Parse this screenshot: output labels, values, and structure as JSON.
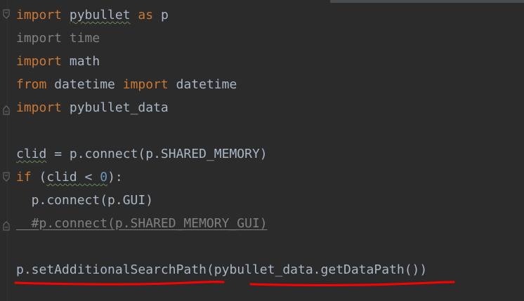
{
  "code": {
    "line1": {
      "kw1": "import",
      "mod": "pybullet",
      "kw2": "as",
      "alias": "p"
    },
    "line2": {
      "kw": "import",
      "mod": "time"
    },
    "line3": {
      "kw": "import",
      "mod": "math"
    },
    "line4": {
      "kw1": "from",
      "mod": "datetime",
      "kw2": "import",
      "name": "datetime"
    },
    "line5": {
      "kw": "import",
      "mod": "pybullet_data"
    },
    "line7": {
      "var": "clid",
      "rest": " = p.connect(p.SHARED_MEMORY)"
    },
    "line8": {
      "kw": "if",
      "open": " (",
      "cond": "clid < ",
      "num": "0",
      "close": "):"
    },
    "line9": {
      "text": "  p.connect(p.GUI)"
    },
    "line10": {
      "text": "  #p.connect(p.SHARED_MEMORY_GUI)"
    },
    "line12": {
      "a": "p.setAdditionalSearchPath",
      "b": "(",
      "c": "pybullet_data.getDataPath",
      "d": "())"
    }
  },
  "colors": {
    "background": "#2b2b2b",
    "keyword": "#cc7832",
    "default": "#a9b7c6",
    "comment": "#808080",
    "number": "#6897bb",
    "annotation": "#ff0000"
  },
  "icons": [
    "fold-marker-icon"
  ]
}
